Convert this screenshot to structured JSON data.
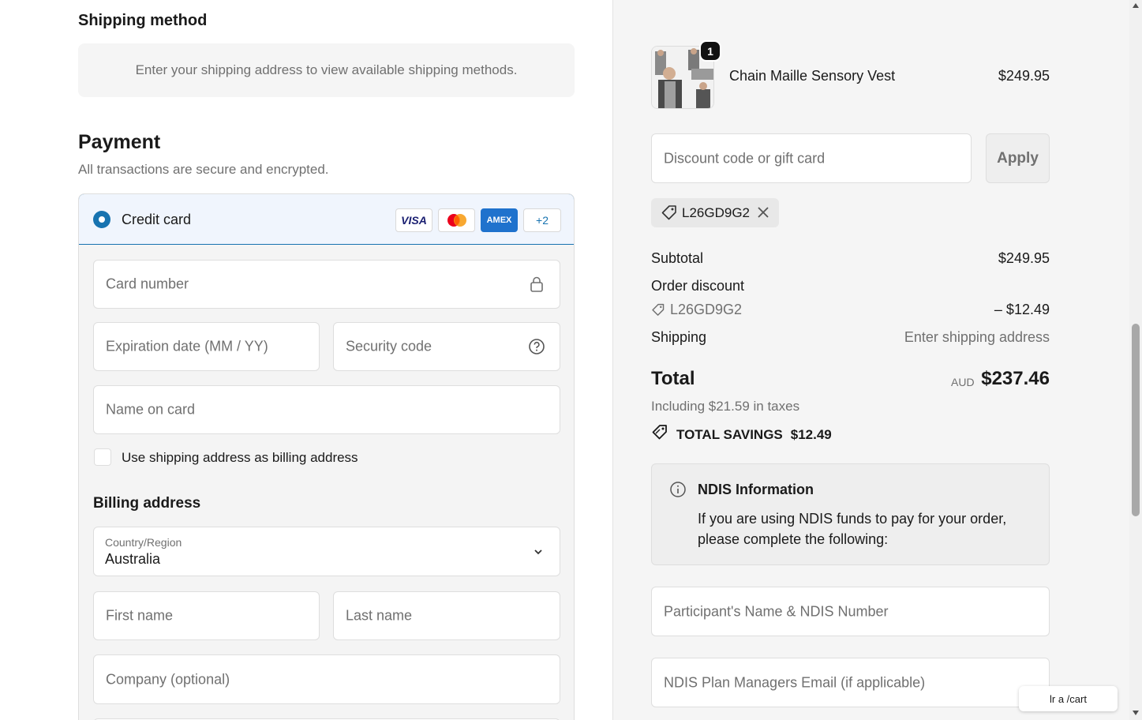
{
  "shipping": {
    "heading": "Shipping method",
    "message": "Enter your shipping address to view available shipping methods."
  },
  "payment": {
    "heading": "Payment",
    "subtitle": "All transactions are secure and encrypted.",
    "method_label": "Credit card",
    "brands": {
      "visa": "VISA",
      "amex": "AMEX",
      "more": "+2"
    },
    "card_number_placeholder": "Card number",
    "expiry_placeholder": "Expiration date (MM / YY)",
    "cvv_placeholder": "Security code",
    "name_placeholder": "Name on card",
    "use_shipping_label": "Use shipping address as billing address"
  },
  "billing": {
    "heading": "Billing address",
    "country_label": "Country/Region",
    "country_value": "Australia",
    "first_name_placeholder": "First name",
    "last_name_placeholder": "Last name",
    "company_placeholder": "Company (optional)"
  },
  "summary": {
    "product": {
      "name": "Chain Maille Sensory Vest",
      "price": "$249.95",
      "quantity": "1"
    },
    "discount_placeholder": "Discount code or gift card",
    "apply_label": "Apply",
    "applied_code": "L26GD9G2",
    "subtotal_label": "Subtotal",
    "subtotal_value": "$249.95",
    "order_discount_label": "Order discount",
    "discount_code": "L26GD9G2",
    "discount_value": "– $12.49",
    "shipping_label": "Shipping",
    "shipping_value": "Enter shipping address",
    "total_label": "Total",
    "currency": "AUD",
    "total_value": "$237.46",
    "tax_note": "Including $21.59 in taxes",
    "savings_label": "TOTAL SAVINGS",
    "savings_value": "$12.49"
  },
  "ndis": {
    "title": "NDIS Information",
    "text": "If you are using NDIS funds to pay for your order, please complete the following:",
    "participant_placeholder": "Participant's Name & NDIS Number",
    "plan_manager_placeholder": "NDIS Plan Managers Email (if applicable)"
  },
  "tooltip": "lr a /cart",
  "colors": {
    "accent": "#1773b0",
    "selected_bg": "#f0f5fd",
    "panel_bg": "#f5f5f5"
  }
}
